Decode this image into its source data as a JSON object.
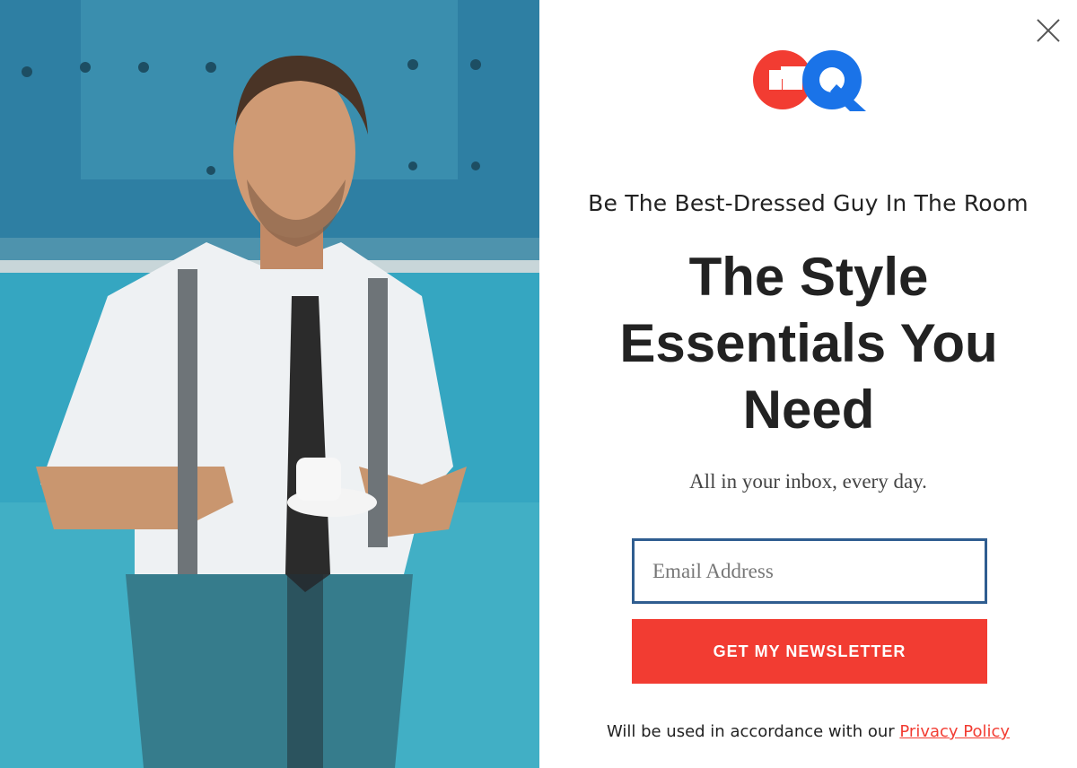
{
  "brand": {
    "logo_text": "GQ",
    "colors": {
      "g": "#f23c32",
      "q": "#1a73e8"
    }
  },
  "close_icon": "close-icon",
  "tagline": "Be The Best-Dressed Guy In The Room",
  "headline": "The Style Essentials You Need",
  "subline": "All in your inbox, every day.",
  "email": {
    "placeholder": "Email Address",
    "value": ""
  },
  "submit_label": "GET MY NEWSLETTER",
  "legal": {
    "text": "Will be used in accordance with our ",
    "link_label": "Privacy Policy"
  },
  "colors": {
    "accent": "#f23c32",
    "input_border": "#2f5d90",
    "text": "#222222"
  }
}
